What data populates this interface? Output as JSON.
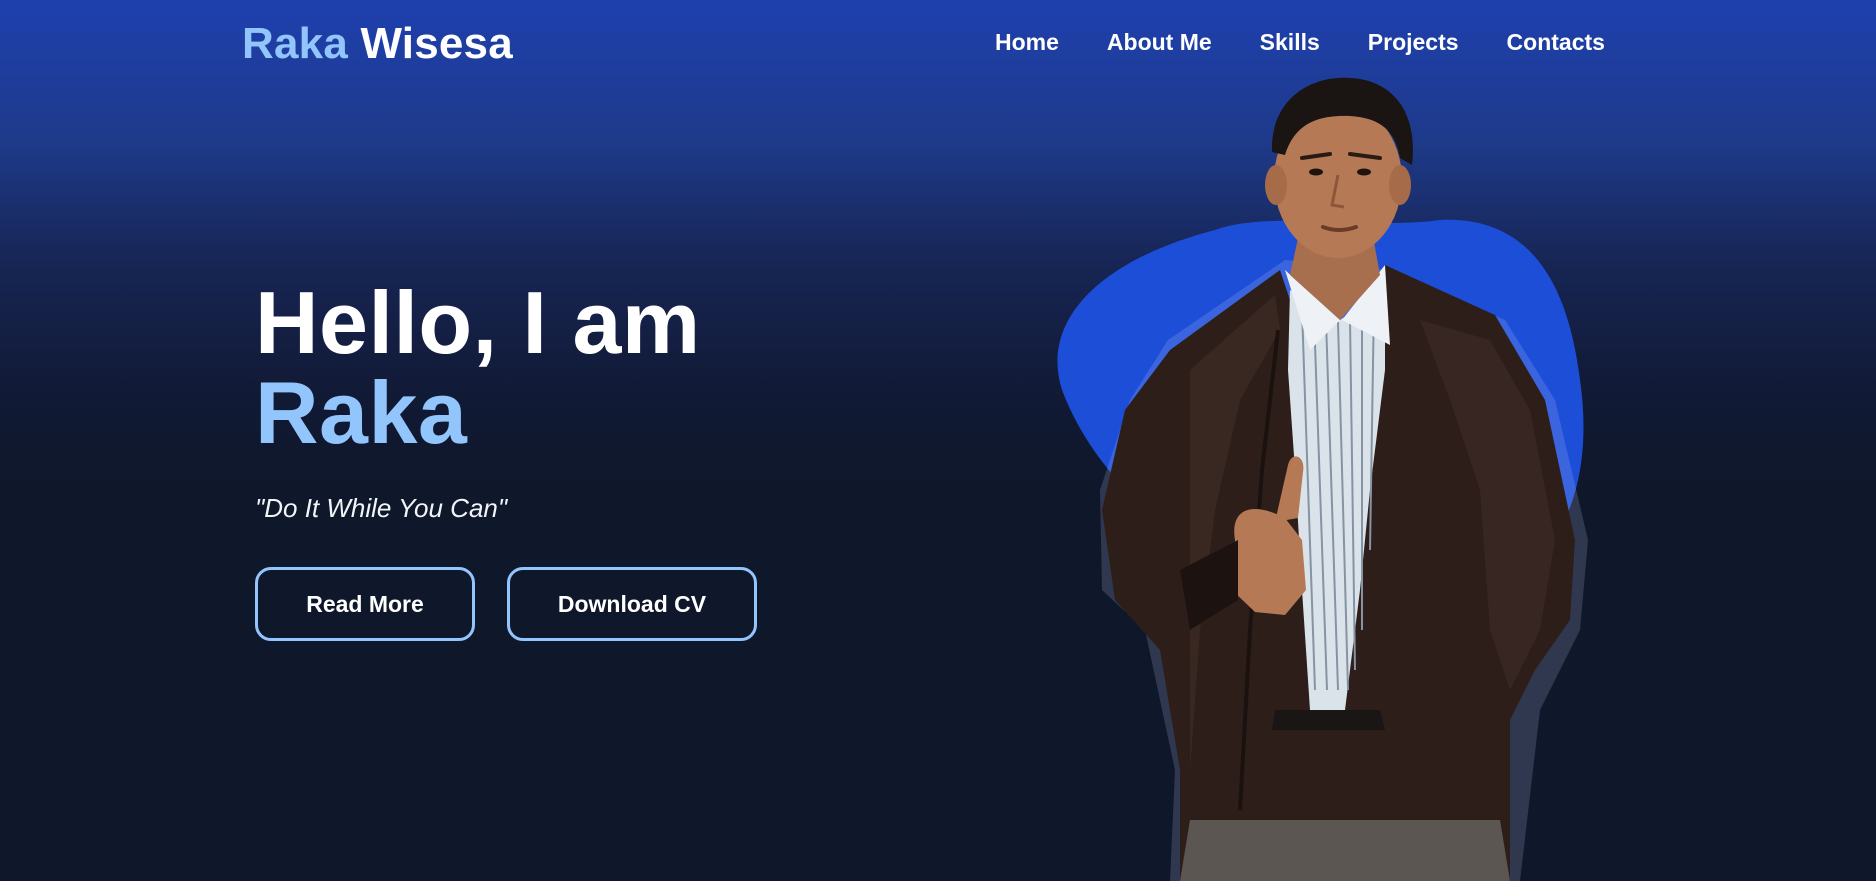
{
  "brand": {
    "first_name": "Raka",
    "last_name": "Wisesa"
  },
  "nav": {
    "items": [
      {
        "label": "Home"
      },
      {
        "label": "About Me"
      },
      {
        "label": "Skills"
      },
      {
        "label": "Projects"
      },
      {
        "label": "Contacts"
      }
    ]
  },
  "hero": {
    "greeting": "Hello, I am",
    "name": "Raka",
    "tagline": "\"Do It While You Can\"",
    "read_more_label": "Read More",
    "download_cv_label": "Download CV"
  },
  "colors": {
    "accent": "#93c5fd",
    "blob": "#1d4ed8",
    "background_top": "#1e40af",
    "background_bottom": "#0f172a"
  }
}
